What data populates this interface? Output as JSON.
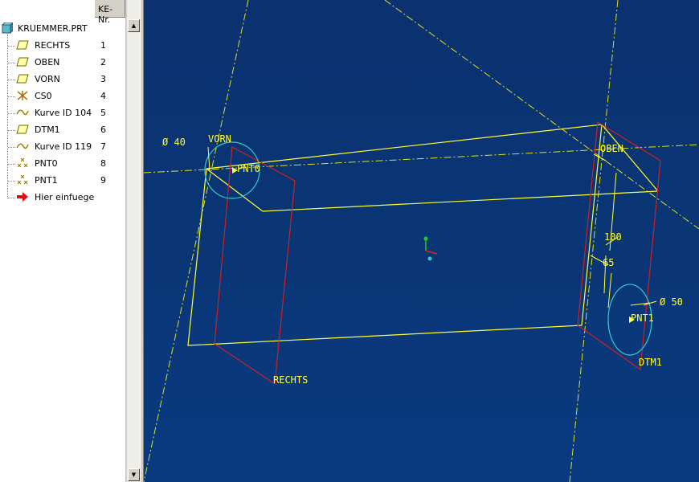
{
  "model_tree": {
    "column_header": "KE-Nr.",
    "root_label": "KRUEMMER.PRT",
    "items": [
      {
        "label": "RECHTS",
        "number": "1",
        "icon": "datum-plane-icon"
      },
      {
        "label": "OBEN",
        "number": "2",
        "icon": "datum-plane-icon"
      },
      {
        "label": "VORN",
        "number": "3",
        "icon": "datum-plane-icon"
      },
      {
        "label": "CS0",
        "number": "4",
        "icon": "coordinate-system-icon"
      },
      {
        "label": "Kurve ID 104",
        "number": "5",
        "icon": "curve-icon"
      },
      {
        "label": "DTM1",
        "number": "6",
        "icon": "datum-plane-icon"
      },
      {
        "label": "Kurve ID 119",
        "number": "7",
        "icon": "curve-icon"
      },
      {
        "label": "PNT0",
        "number": "8",
        "icon": "datum-point-icon"
      },
      {
        "label": "PNT1",
        "number": "9",
        "icon": "datum-point-icon"
      },
      {
        "label": "Hier einfuegen",
        "number": "",
        "icon": "insert-here-arrow-icon"
      }
    ]
  },
  "viewport": {
    "labels": {
      "dia_left": "Ø 40",
      "vorn": "VORN",
      "pnt0": "PNT0",
      "oben": "OBEN",
      "dim_100": "100",
      "dim_65": "65",
      "dia_right": "Ø 50",
      "pnt1": "PNT1",
      "rechts": "RECHTS",
      "dtm1": "DTM1"
    },
    "colors": {
      "background": "#0a3574",
      "yellow": "#ffff33",
      "red": "#cc2222",
      "cyan": "#33cccc"
    }
  }
}
